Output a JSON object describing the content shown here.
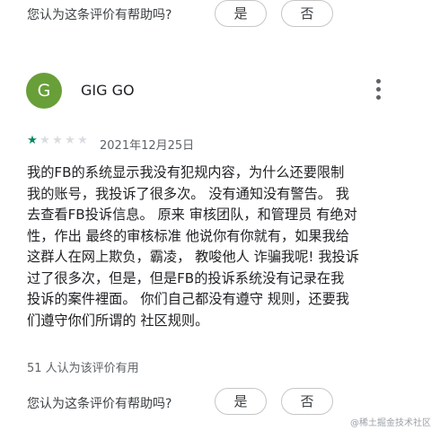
{
  "top_helpful": {
    "question": "您认为这条评价有帮助吗?",
    "yes_label": "是",
    "no_label": "否"
  },
  "review": {
    "avatar_letter": "G",
    "avatar_color": "#689f38",
    "author": "GIG GO",
    "rating": 1,
    "rating_max": 5,
    "star_color": "#01875f",
    "date": "2021年12月25日",
    "body_lines": [
      "我的FB的系统显示我没有犯规内容，为什么还要限制",
      "我的账号，我投诉了很多次。 没有通知没有警告。 我",
      "去查看FB投诉信息。 原来 审核团队，和管理员 有绝对",
      "性，作出 最终的审核标准 他说你有你就有，如果我给",
      "这群人在网上欺负，霸凌，  教唆他人 诈骗我呢! 我投诉",
      "过了很多次，但是，但是FB的投诉系统没有记录在我",
      "投诉的案件裡面。 你们自己都没有遵守 规则，还要我",
      "们遵守你们所谓的 社区规则。"
    ],
    "helpful_count_text": "51 人认为该评价有用"
  },
  "bottom_helpful": {
    "question": "您认为这条评价有帮助吗?",
    "yes_label": "是",
    "no_label": "否"
  },
  "icons": {
    "more": "more-vert-icon",
    "star": "star-icon"
  },
  "watermark": "@稀土掘金技术社区"
}
